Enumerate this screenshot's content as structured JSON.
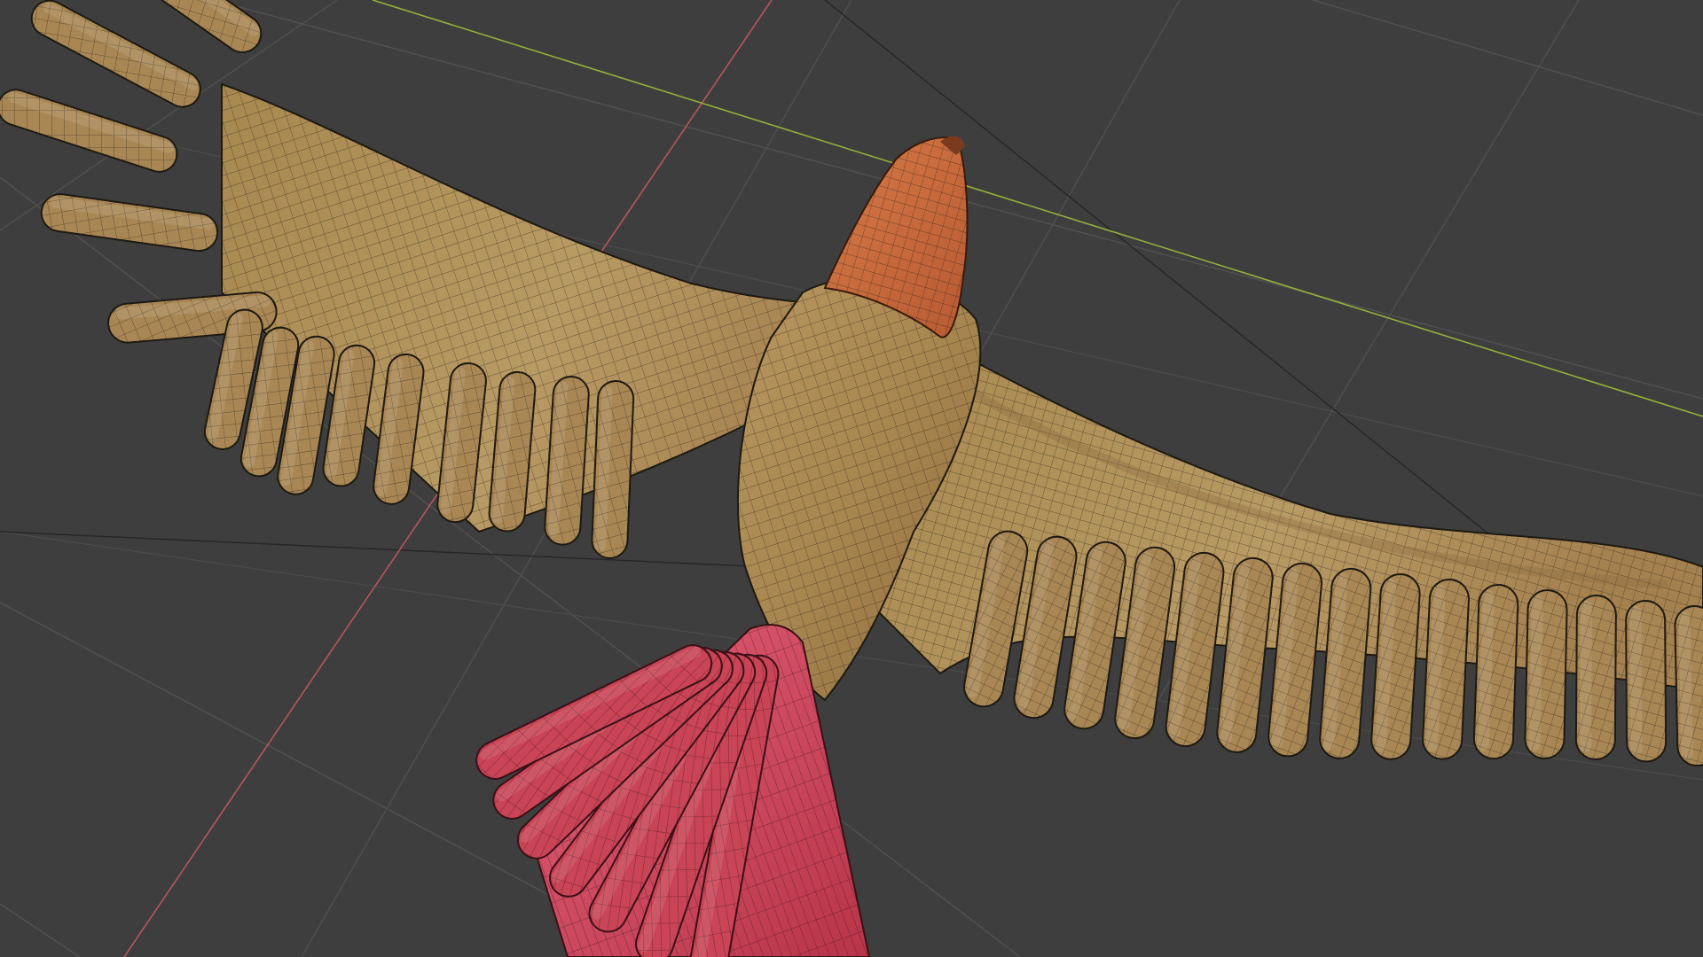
{
  "viewport": {
    "background": "#3e3e3e",
    "grid_color": "#4f4f4f",
    "grid_dark_color": "#262626",
    "axis_x_color": "#b7565d",
    "axis_y_color": "#93b03a"
  },
  "model": {
    "body_color": "#a98754",
    "body_highlight": "#c2a46c",
    "head_color": "#c8693e",
    "head_highlight": "#e08855",
    "tail_color": "#c94456",
    "tail_highlight": "#e0607a",
    "wire_color": "#1e1a12",
    "left_wing_feather_count": 9,
    "right_wing_feather_count": 15,
    "tail_feather_count": 7
  }
}
